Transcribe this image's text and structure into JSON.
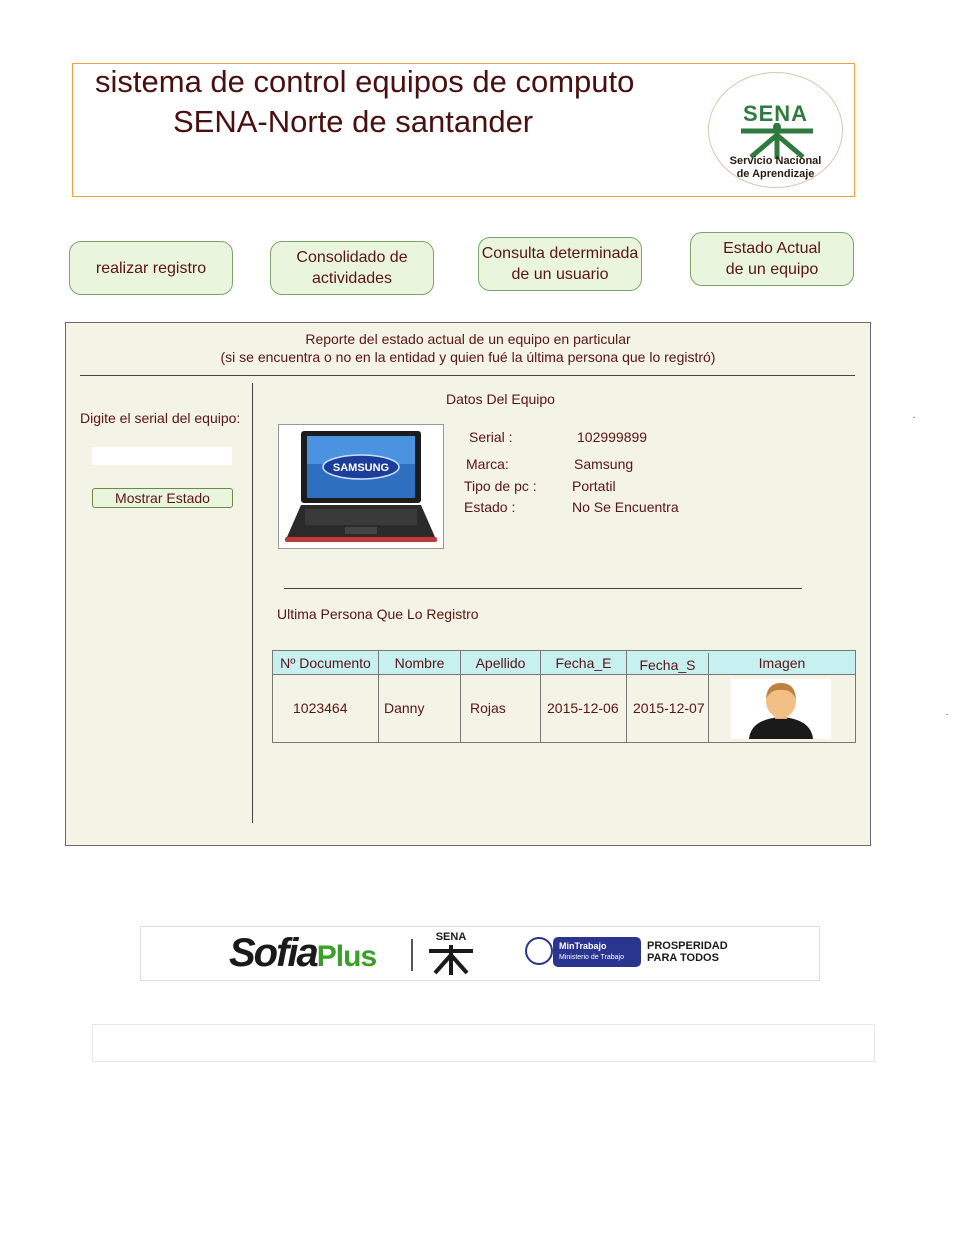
{
  "header": {
    "title_line1": "sistema de control equipos de computo",
    "title_line2": "SENA-Norte de santander",
    "logo": {
      "brand": "SENA",
      "sub_line1": "Servicio Nacional",
      "sub_line2": "de Aprendizaje",
      "icon": "sena-logo-icon",
      "color": "#2f7a3f"
    }
  },
  "nav": {
    "btn_registro": "realizar registro",
    "btn_consolidado": "Consolidado de\nactividades",
    "btn_consulta": "Consulta determinada\nde un usuario",
    "btn_estado": "Estado Actual\nde un equipo"
  },
  "report": {
    "title_line1": "Reporte del estado actual de un equipo en particular",
    "title_line2": "(si se encuentra o no en la entidad y quien fué la última persona que lo registró)",
    "serial_prompt": "Digite el serial del equipo:",
    "serial_input_value": "",
    "show_button": "Mostrar Estado",
    "datos_title": "Datos Del Equipo",
    "laptop_brand_text": "SAMSUNG",
    "fields": {
      "serial_label": "Serial :",
      "serial_value": "102999899",
      "marca_label": "Marca:",
      "marca_value": "Samsung",
      "tipo_label": "Tipo de pc   :",
      "tipo_value": "Portatil",
      "estado_label": "Estado :",
      "estado_value": "No Se Encuentra"
    },
    "ultima_title": "Ultima Persona Que Lo Registro",
    "table": {
      "headers": [
        "Nº Documento",
        "Nombre",
        "Apellido",
        "Fecha_E",
        "Fecha_S",
        "Imagen"
      ],
      "row": [
        "1023464",
        "Danny",
        "Rojas",
        "2015-12-06",
        "2015-12-07"
      ],
      "avatar_icon": "user-avatar-icon"
    }
  },
  "footer": {
    "sofia": "Sofia",
    "plus": "Plus",
    "sena": "SENA",
    "mintrabajo_line1": "MinTrabajo",
    "mintrabajo_line2": "Ministerio de Trabajo",
    "prosperidad_line1": "PROSPERIDAD",
    "prosperidad_line2": "PARA TODOS"
  },
  "colors": {
    "text": "#5a1414",
    "button_bg": "#e9f6dd",
    "panel_bg": "#f3f3e6",
    "table_header_bg": "#c7f0f0",
    "header_border": "#f0a040"
  }
}
